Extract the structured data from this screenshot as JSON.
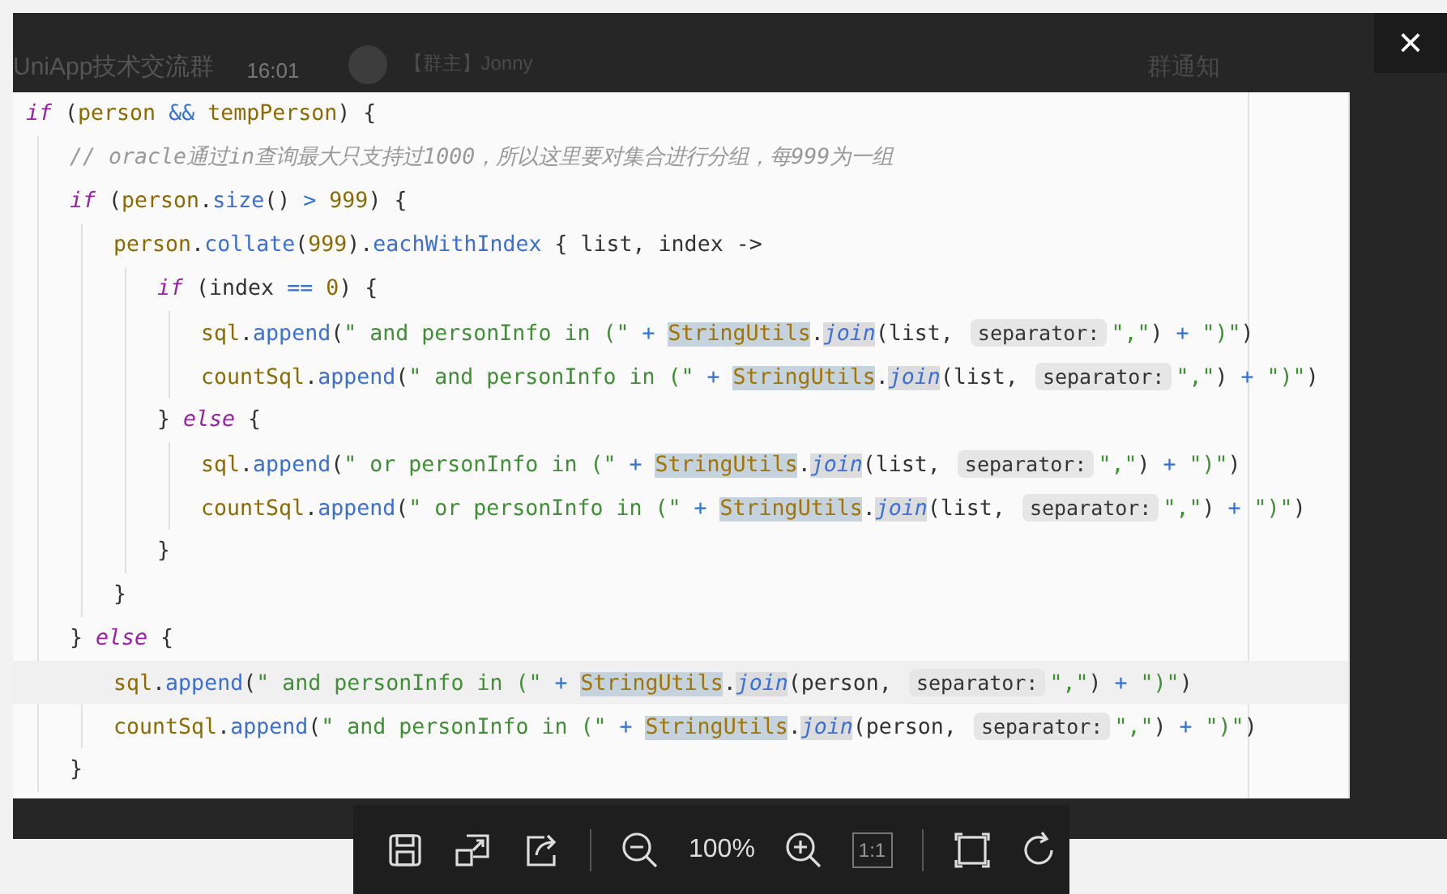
{
  "background_chat": {
    "group_name": "UniApp技术交流群",
    "time": "16:01",
    "sender": "【群主】Jonny",
    "notice": "群通知"
  },
  "close": {
    "label": "×"
  },
  "code": [
    {
      "highlighted": false,
      "tokens": [
        {
          "kind": "kw",
          "t": "if"
        },
        {
          "kind": "plain",
          "t": " ("
        },
        {
          "kind": "var",
          "t": "person"
        },
        {
          "kind": "op",
          "t": " && "
        },
        {
          "kind": "var",
          "t": "tempPerson"
        },
        {
          "kind": "plain",
          "t": ") {"
        }
      ],
      "children": [
        {
          "highlighted": false,
          "tokens": [
            {
              "kind": "comment",
              "t": "// oracle通过in查询最大只支持过1000，所以这里要对集合进行分组，每999为一组"
            }
          ]
        },
        {
          "highlighted": false,
          "tokens": [
            {
              "kind": "kw",
              "t": "if"
            },
            {
              "kind": "plain",
              "t": " ("
            },
            {
              "kind": "var",
              "t": "person"
            },
            {
              "kind": "plain",
              "t": "."
            },
            {
              "kind": "method",
              "t": "size"
            },
            {
              "kind": "plain",
              "t": "()"
            },
            {
              "kind": "op",
              "t": " > "
            },
            {
              "kind": "num",
              "t": "999"
            },
            {
              "kind": "plain",
              "t": ") {"
            }
          ],
          "children": [
            {
              "highlighted": false,
              "tokens": [
                {
                  "kind": "var",
                  "t": "person"
                },
                {
                  "kind": "plain",
                  "t": "."
                },
                {
                  "kind": "method",
                  "t": "collate"
                },
                {
                  "kind": "plain",
                  "t": "("
                },
                {
                  "kind": "num",
                  "t": "999"
                },
                {
                  "kind": "plain",
                  "t": ")."
                },
                {
                  "kind": "method",
                  "t": "eachWithIndex"
                },
                {
                  "kind": "plain",
                  "t": " { list, index ->"
                }
              ],
              "children": [
                {
                  "highlighted": false,
                  "tokens": [
                    {
                      "kind": "kw",
                      "t": "if"
                    },
                    {
                      "kind": "plain",
                      "t": " (index"
                    },
                    {
                      "kind": "op",
                      "t": " == "
                    },
                    {
                      "kind": "num",
                      "t": "0"
                    },
                    {
                      "kind": "plain",
                      "t": ") {"
                    }
                  ],
                  "children": [
                    {
                      "highlighted": false,
                      "tokens": [
                        {
                          "kind": "var",
                          "t": "sql"
                        },
                        {
                          "kind": "plain",
                          "t": "."
                        },
                        {
                          "kind": "method",
                          "t": "append"
                        },
                        {
                          "kind": "plain",
                          "t": "("
                        },
                        {
                          "kind": "str",
                          "t": "\" and personInfo in (\""
                        },
                        {
                          "kind": "op",
                          "t": " + "
                        },
                        {
                          "kind": "cls",
                          "t": "StringUtils"
                        },
                        {
                          "kind": "plain",
                          "t": "."
                        },
                        {
                          "kind": "static",
                          "t": "join"
                        },
                        {
                          "kind": "plain",
                          "t": "(list, "
                        },
                        {
                          "kind": "hint",
                          "t": "separator:"
                        },
                        {
                          "kind": "str",
                          "t": "\",\""
                        },
                        {
                          "kind": "plain",
                          "t": ")"
                        },
                        {
                          "kind": "op",
                          "t": " + "
                        },
                        {
                          "kind": "str",
                          "t": "\")\""
                        },
                        {
                          "kind": "plain",
                          "t": ")"
                        }
                      ]
                    },
                    {
                      "highlighted": false,
                      "tokens": [
                        {
                          "kind": "var",
                          "t": "countSql"
                        },
                        {
                          "kind": "plain",
                          "t": "."
                        },
                        {
                          "kind": "method",
                          "t": "append"
                        },
                        {
                          "kind": "plain",
                          "t": "("
                        },
                        {
                          "kind": "str",
                          "t": "\" and personInfo in (\""
                        },
                        {
                          "kind": "op",
                          "t": " + "
                        },
                        {
                          "kind": "cls",
                          "t": "StringUtils"
                        },
                        {
                          "kind": "plain",
                          "t": "."
                        },
                        {
                          "kind": "static",
                          "t": "join"
                        },
                        {
                          "kind": "plain",
                          "t": "(list, "
                        },
                        {
                          "kind": "hint",
                          "t": "separator:"
                        },
                        {
                          "kind": "str",
                          "t": "\",\""
                        },
                        {
                          "kind": "plain",
                          "t": ")"
                        },
                        {
                          "kind": "op",
                          "t": " + "
                        },
                        {
                          "kind": "str",
                          "t": "\")\""
                        },
                        {
                          "kind": "plain",
                          "t": ")"
                        }
                      ]
                    }
                  ]
                },
                {
                  "highlighted": false,
                  "tokens": [
                    {
                      "kind": "plain",
                      "t": "} "
                    },
                    {
                      "kind": "kw",
                      "t": "else"
                    },
                    {
                      "kind": "plain",
                      "t": " {"
                    }
                  ],
                  "children": [
                    {
                      "highlighted": false,
                      "tokens": [
                        {
                          "kind": "var",
                          "t": "sql"
                        },
                        {
                          "kind": "plain",
                          "t": "."
                        },
                        {
                          "kind": "method",
                          "t": "append"
                        },
                        {
                          "kind": "plain",
                          "t": "("
                        },
                        {
                          "kind": "str",
                          "t": "\" or personInfo in (\""
                        },
                        {
                          "kind": "op",
                          "t": " + "
                        },
                        {
                          "kind": "cls",
                          "t": "StringUtils"
                        },
                        {
                          "kind": "plain",
                          "t": "."
                        },
                        {
                          "kind": "static",
                          "t": "join"
                        },
                        {
                          "kind": "plain",
                          "t": "(list, "
                        },
                        {
                          "kind": "hint",
                          "t": "separator:"
                        },
                        {
                          "kind": "str",
                          "t": "\",\""
                        },
                        {
                          "kind": "plain",
                          "t": ")"
                        },
                        {
                          "kind": "op",
                          "t": " + "
                        },
                        {
                          "kind": "str",
                          "t": "\")\""
                        },
                        {
                          "kind": "plain",
                          "t": ")"
                        }
                      ]
                    },
                    {
                      "highlighted": false,
                      "tokens": [
                        {
                          "kind": "var",
                          "t": "countSql"
                        },
                        {
                          "kind": "plain",
                          "t": "."
                        },
                        {
                          "kind": "method",
                          "t": "append"
                        },
                        {
                          "kind": "plain",
                          "t": "("
                        },
                        {
                          "kind": "str",
                          "t": "\" or personInfo in (\""
                        },
                        {
                          "kind": "op",
                          "t": " + "
                        },
                        {
                          "kind": "cls",
                          "t": "StringUtils"
                        },
                        {
                          "kind": "plain",
                          "t": "."
                        },
                        {
                          "kind": "static",
                          "t": "join"
                        },
                        {
                          "kind": "plain",
                          "t": "(list, "
                        },
                        {
                          "kind": "hint",
                          "t": "separator:"
                        },
                        {
                          "kind": "str",
                          "t": "\",\""
                        },
                        {
                          "kind": "plain",
                          "t": ")"
                        },
                        {
                          "kind": "op",
                          "t": " + "
                        },
                        {
                          "kind": "str",
                          "t": "\")\""
                        },
                        {
                          "kind": "plain",
                          "t": ")"
                        }
                      ]
                    }
                  ]
                },
                {
                  "highlighted": false,
                  "tokens": [
                    {
                      "kind": "plain",
                      "t": "}"
                    }
                  ]
                }
              ]
            },
            {
              "highlighted": false,
              "tokens": [
                {
                  "kind": "plain",
                  "t": "}"
                }
              ]
            }
          ]
        },
        {
          "highlighted": false,
          "tokens": [
            {
              "kind": "plain",
              "t": "} "
            },
            {
              "kind": "kw",
              "t": "else"
            },
            {
              "kind": "plain",
              "t": " {"
            }
          ],
          "children": [
            {
              "highlighted": true,
              "tokens": [
                {
                  "kind": "var",
                  "t": "sql"
                },
                {
                  "kind": "plain",
                  "t": "."
                },
                {
                  "kind": "method",
                  "t": "append"
                },
                {
                  "kind": "plain",
                  "t": "("
                },
                {
                  "kind": "str",
                  "t": "\" and personInfo in (\""
                },
                {
                  "kind": "op",
                  "t": " + "
                },
                {
                  "kind": "cls",
                  "t": "StringUtils"
                },
                {
                  "kind": "plain",
                  "t": "."
                },
                {
                  "kind": "static",
                  "t": "join"
                },
                {
                  "kind": "plain",
                  "t": "(person, "
                },
                {
                  "kind": "hint",
                  "t": "separator:"
                },
                {
                  "kind": "str",
                  "t": "\",\""
                },
                {
                  "kind": "plain",
                  "t": ")"
                },
                {
                  "kind": "op",
                  "t": " + "
                },
                {
                  "kind": "str",
                  "t": "\")\""
                },
                {
                  "kind": "plain",
                  "t": ")"
                }
              ]
            },
            {
              "highlighted": false,
              "tokens": [
                {
                  "kind": "var",
                  "t": "countSql"
                },
                {
                  "kind": "plain",
                  "t": "."
                },
                {
                  "kind": "method",
                  "t": "append"
                },
                {
                  "kind": "plain",
                  "t": "("
                },
                {
                  "kind": "str",
                  "t": "\" and personInfo in (\""
                },
                {
                  "kind": "op",
                  "t": " + "
                },
                {
                  "kind": "cls",
                  "t": "StringUtils"
                },
                {
                  "kind": "plain",
                  "t": "."
                },
                {
                  "kind": "static",
                  "t": "join"
                },
                {
                  "kind": "plain",
                  "t": "(person, "
                },
                {
                  "kind": "hint",
                  "t": "separator:"
                },
                {
                  "kind": "str",
                  "t": "\",\""
                },
                {
                  "kind": "plain",
                  "t": ")"
                },
                {
                  "kind": "op",
                  "t": " + "
                },
                {
                  "kind": "str",
                  "t": "\")\""
                },
                {
                  "kind": "plain",
                  "t": ")"
                }
              ]
            }
          ]
        },
        {
          "highlighted": false,
          "tokens": [
            {
              "kind": "plain",
              "t": "}"
            }
          ]
        }
      ]
    }
  ],
  "toolbar": [
    {
      "kind": "save"
    },
    {
      "kind": "resize"
    },
    {
      "kind": "share"
    },
    {
      "kind": "sep"
    },
    {
      "kind": "zoomout"
    },
    {
      "kind": "text",
      "label": "100%"
    },
    {
      "kind": "zoomin"
    },
    {
      "kind": "box",
      "label": "1:1",
      "disabled": true
    },
    {
      "kind": "sep"
    },
    {
      "kind": "fit"
    },
    {
      "kind": "rotate"
    }
  ]
}
